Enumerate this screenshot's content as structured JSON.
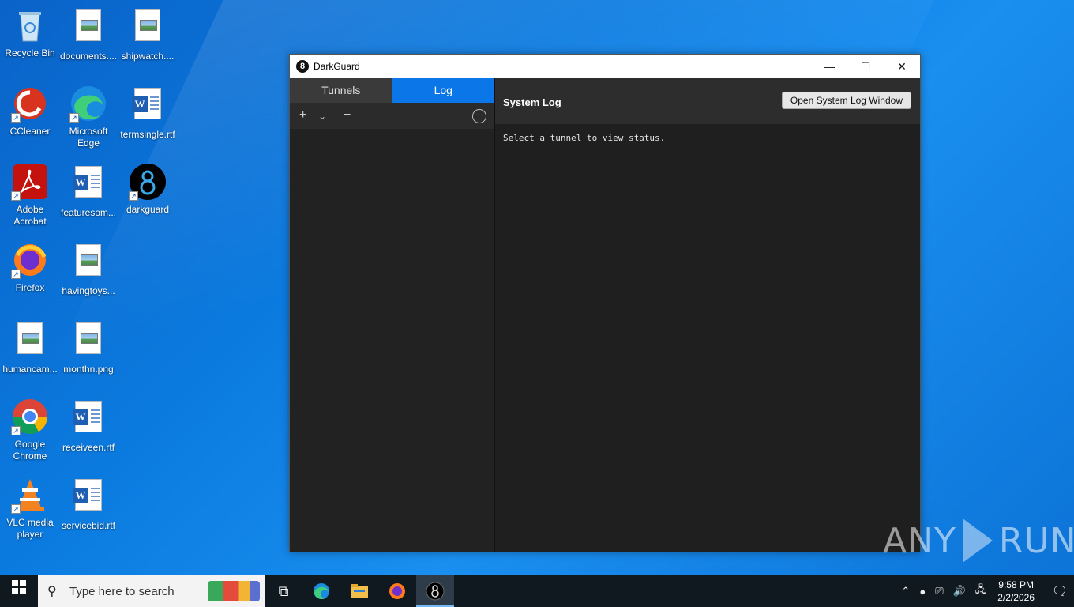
{
  "desktop": {
    "icons": [
      {
        "label": "Recycle Bin"
      },
      {
        "label": "documents...."
      },
      {
        "label": "shipwatch...."
      },
      {
        "label": "CCleaner"
      },
      {
        "label": "Microsoft Edge"
      },
      {
        "label": "termsingle.rtf"
      },
      {
        "label": "Adobe Acrobat"
      },
      {
        "label": "featuresom..."
      },
      {
        "label": "darkguard"
      },
      {
        "label": "Firefox"
      },
      {
        "label": "havingtoys..."
      },
      {
        "label": "humancam..."
      },
      {
        "label": "monthn.png"
      },
      {
        "label": "Google Chrome"
      },
      {
        "label": "receiveen.rtf"
      },
      {
        "label": "VLC media player"
      },
      {
        "label": "servicebid.rtf"
      }
    ]
  },
  "window": {
    "title": "DarkGuard",
    "controls": {
      "minimize": "—",
      "maximize": "☐",
      "close": "✕"
    },
    "tabs": [
      {
        "label": "Tunnels",
        "active": false
      },
      {
        "label": "Log",
        "active": true
      }
    ],
    "toolbar": {
      "add": "+",
      "dropdown": "⌄",
      "remove": "−",
      "more": "···"
    },
    "log": {
      "title": "System Log",
      "open_button": "Open System Log Window",
      "status_text": "Select a tunnel to view status."
    },
    "accent_color": "#0a76e8"
  },
  "watermark": {
    "left": "ANY",
    "right": "RUN"
  },
  "taskbar": {
    "search_placeholder": "Type here to search",
    "clock_time": "9:58 PM",
    "clock_date": "2/2/2026"
  }
}
